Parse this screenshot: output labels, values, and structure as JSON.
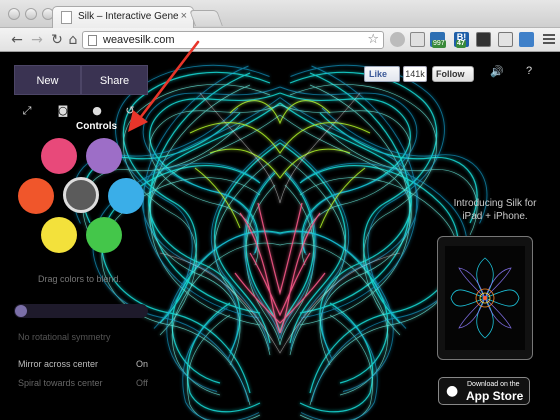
{
  "browser": {
    "tab_title": "Silk – Interactive Generativ",
    "tab_close": "×",
    "url": "weavesilk.com",
    "extensions": [
      {
        "name": "pocket-icon",
        "badge": ""
      },
      {
        "name": "rss-icon",
        "badge": "997"
      },
      {
        "name": "bookmark-icon",
        "badge": "47"
      },
      {
        "name": "clipboard-icon",
        "badge": ""
      },
      {
        "name": "screenshot-icon",
        "badge": ""
      },
      {
        "name": "reader-icon",
        "badge": ""
      }
    ]
  },
  "panel": {
    "new_label": "New",
    "share_label": "Share",
    "controls_label": "Controls",
    "blend_hint": "Drag colors to blend.",
    "swatches": [
      {
        "name": "pink",
        "color": "#e8497a"
      },
      {
        "name": "purple",
        "color": "#9d6ec7"
      },
      {
        "name": "orange",
        "color": "#f0562b"
      },
      {
        "name": "gray",
        "color": "#5b5b5b",
        "selected": true
      },
      {
        "name": "blue",
        "color": "#3aaee8"
      },
      {
        "name": "yellow",
        "color": "#f3e13b"
      },
      {
        "name": "green",
        "color": "#44c64a"
      }
    ],
    "symmetry_label": "No rotational symmetry",
    "mirror_label": "Mirror across center",
    "mirror_value": "On",
    "spiral_label": "Spiral towards center",
    "spiral_value": "Off",
    "symmetry_level": 0
  },
  "social": {
    "like_label": "Like",
    "like_count": "141k",
    "follow_label": "Follow",
    "help_label": "?"
  },
  "promo": {
    "line1": "Introducing Silk for",
    "line2": "iPad + iPhone.",
    "appstore_small": "Download on the",
    "appstore_big": "App Store"
  },
  "colors": {
    "accent_panel": "#3a3352",
    "silk_cyan": "#19e5e0",
    "silk_green": "#b8ff2a",
    "silk_pink": "#ff5a8c",
    "annotation_arrow": "#e8352a"
  }
}
